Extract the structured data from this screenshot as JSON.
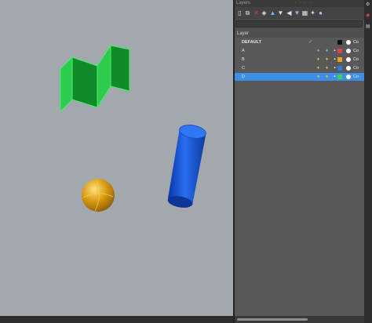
{
  "panel": {
    "title": "Layers",
    "grip": "· · · ·",
    "section_label": "Layer",
    "search": {
      "value": "",
      "placeholder": ""
    }
  },
  "toolbar": {
    "icons": [
      "new-layer-icon",
      "copy-layer-icon",
      "delete-layer-icon",
      "layer-state-icon",
      "move-up-icon",
      "move-down-icon",
      "filter-icon",
      "sort-icon",
      "settings-icon",
      "wand-icon",
      "sphere-icon"
    ]
  },
  "layers": {
    "rows": [
      {
        "name": "DEFAULT",
        "color": "#111111",
        "color_label": "Co",
        "selected": false,
        "current": true
      },
      {
        "name": "A",
        "color": "#e04545",
        "color_label": "Co",
        "selected": false,
        "current": false
      },
      {
        "name": "B",
        "color": "#f0a020",
        "color_label": "Co",
        "selected": false,
        "current": false
      },
      {
        "name": "C",
        "color": "#2a7be0",
        "color_label": "Co",
        "selected": false,
        "current": false
      },
      {
        "name": "D",
        "color": "#3ad25a",
        "color_label": "Co",
        "selected": true,
        "current": false
      }
    ]
  },
  "viewport": {
    "background": "#a3a8ae",
    "objects": [
      "zigzag-surface",
      "cylinder",
      "sphere"
    ],
    "object_colors": {
      "zigzag": "#3ad25a",
      "cylinder": "#1f5bd9",
      "sphere": "#d79a12"
    }
  }
}
